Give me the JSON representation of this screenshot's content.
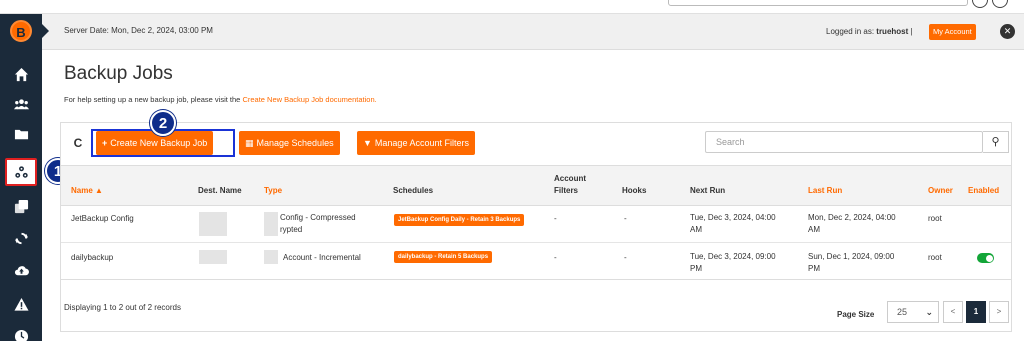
{
  "header": {
    "server_date": "Server Date: Mon, Dec 2, 2024, 03:00 PM",
    "logged_in_prefix": "Logged in as:",
    "username": "truehost",
    "separator": "|",
    "my_account": "My Account",
    "close_icon": "close-icon"
  },
  "sidebar": {
    "logo": "B",
    "icons": [
      "home-icon",
      "users-icon",
      "folder-icon",
      "backup-jobs-icon",
      "clone-icon",
      "sync-icon",
      "cloud-upload-icon",
      "warning-icon",
      "clock-icon"
    ],
    "active_index": 3
  },
  "annotations": {
    "badge_1": "1",
    "badge_2": "2"
  },
  "page": {
    "title": "Backup Jobs",
    "help_text": "For help setting up a new backup job, please visit the",
    "help_link": "Create New Backup Job documentation."
  },
  "toolbar": {
    "refresh_icon": "refresh-icon",
    "create_label": "Create New Backup Job",
    "schedules_label": "Manage Schedules",
    "filters_label": "Manage Account Filters",
    "search_placeholder": "Search",
    "search_icon": "search-icon"
  },
  "table": {
    "columns": {
      "name": "Name",
      "dest": "Dest. Name",
      "type": "Type",
      "schedules": "Schedules",
      "filters_1": "Account",
      "filters_2": "Filters",
      "hooks": "Hooks",
      "next_run": "Next Run",
      "last_run": "Last Run",
      "owner": "Owner",
      "enabled": "Enabled"
    },
    "rows": [
      {
        "name": "JetBackup Config",
        "type_1": "Config - Compressed",
        "type_2": "rypted",
        "schedule": "JetBackup Config Daily - Retain 3 Backups",
        "filters": "-",
        "hooks": "-",
        "next_run_1": "Tue, Dec 3, 2024, 04:00",
        "next_run_2": "AM",
        "last_run_1": "Mon, Dec 2, 2024, 04:00",
        "last_run_2": "AM",
        "owner": "root",
        "enabled": false
      },
      {
        "name": "dailybackup",
        "type_1": "Account - Incremental",
        "type_2": "",
        "schedule": "dailybackup - Retain 5 Backups",
        "filters": "-",
        "hooks": "-",
        "next_run_1": "Tue, Dec 3, 2024, 09:00",
        "next_run_2": "PM",
        "last_run_1": "Sun, Dec 1, 2024, 09:00",
        "last_run_2": "PM",
        "owner": "root",
        "enabled": true
      }
    ]
  },
  "footer": {
    "records": "Displaying 1 to 2 out of 2 records",
    "page_size_label": "Page Size",
    "page_size_value": "25",
    "prev": "<",
    "current_page": "1",
    "next": ">"
  },
  "colors": {
    "accent": "#ff6a00",
    "sidebar": "#1b2a3a",
    "highlight": "#1a33d6",
    "active_outline": "#e02020",
    "toggle_on": "#13a538"
  }
}
